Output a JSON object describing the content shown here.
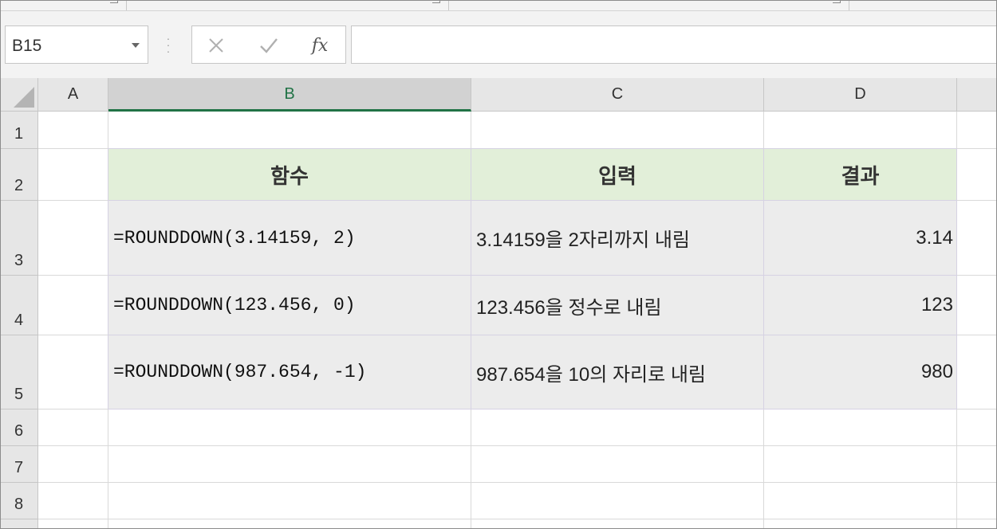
{
  "name_box": {
    "value": "B15"
  },
  "formula_bar": {
    "fx_label": "fx",
    "value": ""
  },
  "columns": [
    "A",
    "B",
    "C",
    "D"
  ],
  "rows": [
    "1",
    "2",
    "3",
    "4",
    "5",
    "6",
    "7",
    "8"
  ],
  "table": {
    "headers": [
      "함수",
      "입력",
      "결과"
    ],
    "rows": [
      {
        "formula": "=ROUNDDOWN(3.14159, 2)",
        "description": "3.14159을 2자리까지 내림",
        "result": "3.14"
      },
      {
        "formula": "=ROUNDDOWN(123.456, 0)",
        "description": "123.456을 정수로 내림",
        "result": "123"
      },
      {
        "formula": "=ROUNDDOWN(987.654, -1)",
        "description": "987.654을 10의 자리로 내림",
        "result": "980"
      }
    ]
  },
  "colors": {
    "header_fill": "#e2efd9",
    "body_fill": "#ececec",
    "active_column": "#217346"
  }
}
